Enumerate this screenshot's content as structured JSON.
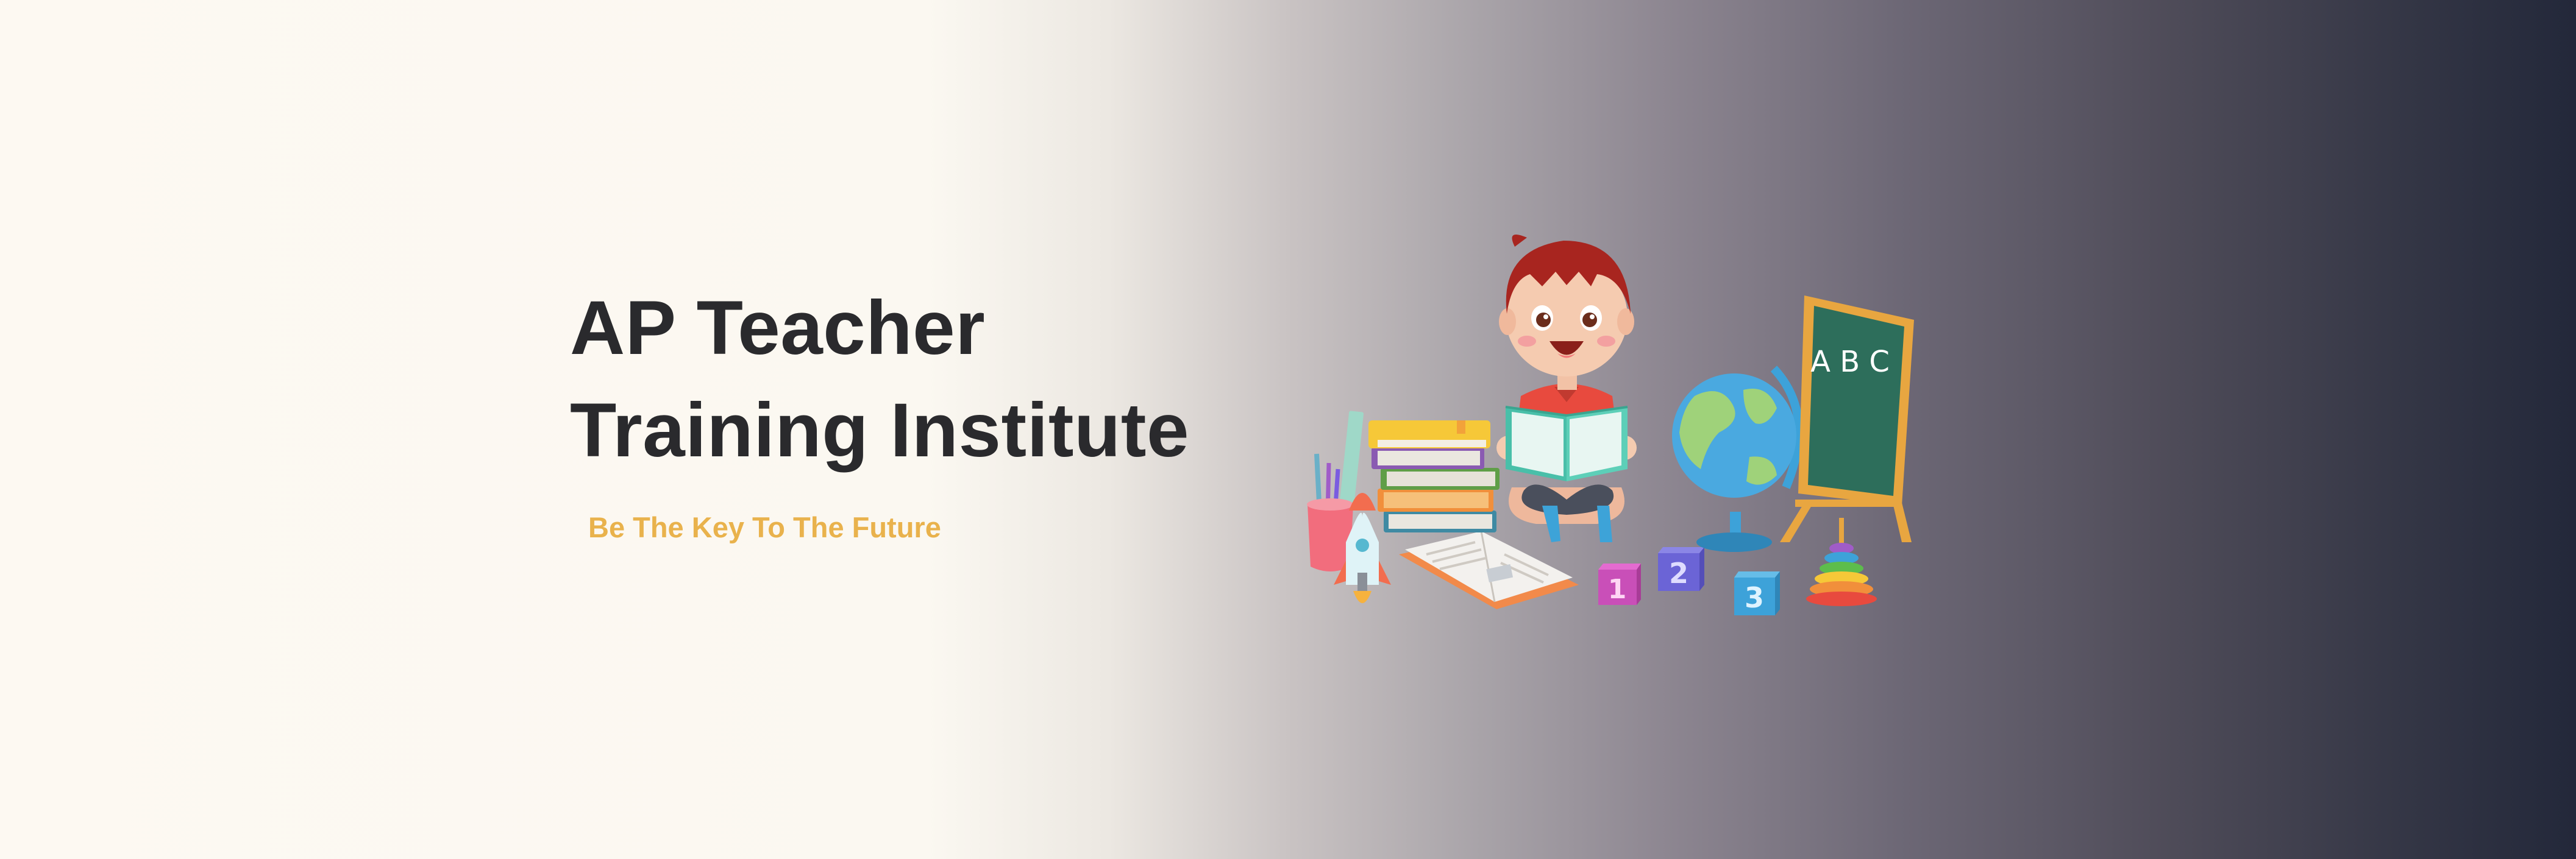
{
  "hero": {
    "title_line1": "AP Teacher",
    "title_line2": "Training Institute",
    "tagline": "Be The Key To The Future"
  },
  "illustration": {
    "chalkboard_text": "A B C",
    "blocks": [
      "1",
      "2",
      "3"
    ],
    "icons": [
      "boy-reading-icon",
      "books-stack-icon",
      "pencil-cup-icon",
      "rocket-icon",
      "open-book-icon",
      "number-block-icon",
      "globe-icon",
      "chalkboard-icon",
      "ring-stacker-icon"
    ]
  },
  "colors": {
    "background_left": "#fdf9f2",
    "background_right": "#23283a",
    "title": "#2a2a2d",
    "tagline": "#e9b24c",
    "chalkboard": "#2d6e5b",
    "chalkboard_frame": "#e8a640"
  }
}
